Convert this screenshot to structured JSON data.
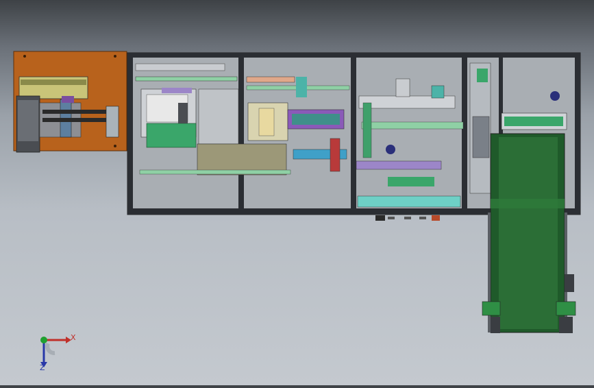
{
  "viewport": {
    "background_top": "#3e4246",
    "background_bottom": "#c4c9cf",
    "model": {
      "plate_color": "#b8621c",
      "frame_color": "#2b2e33",
      "panel_color": "#a9aeb3",
      "conveyor_color": "#1f5a2a",
      "accent_green": "#7cc38b",
      "accent_purple": "#8a5ab8",
      "accent_teal": "#4cb3a8"
    }
  },
  "triad": {
    "x_label": "X",
    "z_label": "Z",
    "x_color": "#c0302a",
    "z_color": "#2838a8",
    "origin_color": "#20a030"
  }
}
